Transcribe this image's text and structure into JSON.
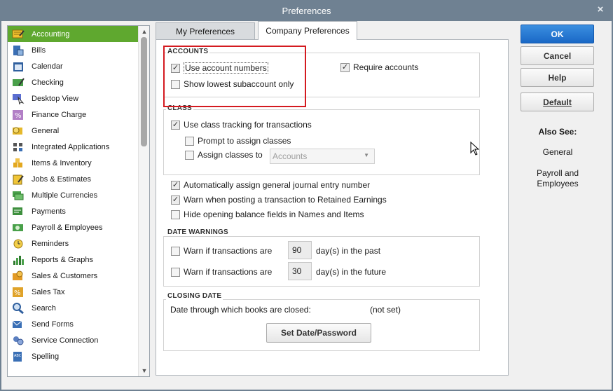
{
  "window": {
    "title": "Preferences",
    "close_glyph": "×"
  },
  "sidebar": {
    "items": [
      {
        "label": "Accounting",
        "icon": "accounting-icon",
        "selected": true
      },
      {
        "label": "Bills",
        "icon": "bills-icon"
      },
      {
        "label": "Calendar",
        "icon": "calendar-icon"
      },
      {
        "label": "Checking",
        "icon": "checking-icon"
      },
      {
        "label": "Desktop View",
        "icon": "desktop-view-icon"
      },
      {
        "label": "Finance Charge",
        "icon": "finance-charge-icon"
      },
      {
        "label": "General",
        "icon": "general-icon"
      },
      {
        "label": "Integrated Applications",
        "icon": "integrated-applications-icon"
      },
      {
        "label": "Items & Inventory",
        "icon": "items-inventory-icon"
      },
      {
        "label": "Jobs & Estimates",
        "icon": "jobs-estimates-icon"
      },
      {
        "label": "Multiple Currencies",
        "icon": "multiple-currencies-icon"
      },
      {
        "label": "Payments",
        "icon": "payments-icon"
      },
      {
        "label": "Payroll & Employees",
        "icon": "payroll-employees-icon"
      },
      {
        "label": "Reminders",
        "icon": "reminders-icon"
      },
      {
        "label": "Reports & Graphs",
        "icon": "reports-graphs-icon"
      },
      {
        "label": "Sales & Customers",
        "icon": "sales-customers-icon"
      },
      {
        "label": "Sales Tax",
        "icon": "sales-tax-icon"
      },
      {
        "label": "Search",
        "icon": "search-icon"
      },
      {
        "label": "Send Forms",
        "icon": "send-forms-icon"
      },
      {
        "label": "Service Connection",
        "icon": "service-connection-icon"
      },
      {
        "label": "Spelling",
        "icon": "spelling-icon"
      }
    ]
  },
  "tabs": {
    "my_preferences": "My Preferences",
    "company_preferences": "Company Preferences",
    "active": "company_preferences"
  },
  "accounts": {
    "title": "ACCOUNTS",
    "use_account_numbers": {
      "label": "Use account numbers",
      "checked": true
    },
    "show_lowest_subaccount": {
      "label": "Show lowest subaccount only",
      "checked": false
    },
    "require_accounts": {
      "label": "Require accounts",
      "checked": true
    }
  },
  "class": {
    "title": "CLASS",
    "use_class_tracking": {
      "label": "Use class tracking for transactions",
      "checked": true
    },
    "prompt_assign_classes": {
      "label": "Prompt to assign classes",
      "checked": false
    },
    "assign_classes_to": {
      "label": "Assign classes to",
      "checked": false
    },
    "assign_select_value": "Accounts"
  },
  "options": {
    "auto_journal_number": {
      "label": "Automatically assign general journal entry number",
      "checked": true
    },
    "warn_retained_earnings": {
      "label": "Warn when posting a transaction to Retained Earnings",
      "checked": true
    },
    "hide_opening_balance": {
      "label": "Hide opening balance fields in Names and Items",
      "checked": false
    }
  },
  "date_warnings": {
    "title": "DATE WARNINGS",
    "past": {
      "label": "Warn if transactions are",
      "checked": false,
      "days": "90",
      "suffix": "day(s) in the past"
    },
    "future": {
      "label": "Warn if transactions are",
      "checked": false,
      "days": "30",
      "suffix": "day(s) in the future"
    }
  },
  "closing_date": {
    "title": "CLOSING DATE",
    "label": "Date through which books are closed:",
    "value": "(not set)",
    "button": "Set Date/Password"
  },
  "buttons": {
    "ok": "OK",
    "cancel": "Cancel",
    "help": "Help",
    "default": "Default"
  },
  "also_see": {
    "title": "Also See:",
    "general": "General",
    "payroll": "Payroll and Employees"
  },
  "colors": {
    "selection": "#5fa82f",
    "primary_button": "#1a68c6",
    "highlight_border": "#d41a20",
    "title_bar": "#6f8192"
  }
}
